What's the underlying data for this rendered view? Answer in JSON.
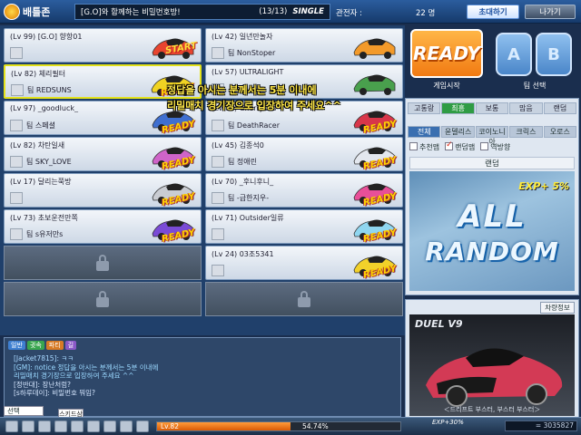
{
  "header": {
    "app_title": "배틀존",
    "room_title": "[G.O]와 함께하는 비밀번호방!",
    "player_count": "(13/13)",
    "mode": "SINGLE",
    "spectator_label": "관전자 :",
    "spectator_count": "22 명",
    "invite_button": "초대하기",
    "exit_button": "나가기"
  },
  "slots": [
    {
      "lv": "(Lv 99) [G.O] 향항01",
      "team": "",
      "car_color": "#e8442f",
      "badge": "START"
    },
    {
      "lv": "(Lv 42) 일년만놀자",
      "team": "팀 NonStoper",
      "car_color": "#f39a2a",
      "badge": ""
    },
    {
      "lv": "(Lv 82) 체리필터",
      "team": "팀 REDSUNS",
      "car_color": "#f0d323",
      "badge": "READY"
    },
    {
      "lv": "(Lv 57) ULTRALIGHT",
      "team": "",
      "car_color": "#49a04d",
      "badge": ""
    },
    {
      "lv": "(Lv 97) _goodluck_",
      "team": "팀 스페셜",
      "car_color": "#3f6fd0",
      "badge": "READY"
    },
    {
      "lv": "(Lv 78) CherryVes",
      "team": "팀 DeathRacer",
      "car_color": "#d8364a",
      "badge": "READY"
    },
    {
      "lv": "(Lv 82) 차탄일새",
      "team": "팀 SKY_LOVE",
      "car_color": "#cf64c9",
      "badge": "READY"
    },
    {
      "lv": "(Lv 45) 김종석0",
      "team": "팀 정애린",
      "car_color": "#e3e7ee",
      "badge": "READY"
    },
    {
      "lv": "(Lv 17) 달리는쭉방",
      "team": "",
      "car_color": "#c9ccd2",
      "badge": "READY"
    },
    {
      "lv": "(Lv 70) _후니후니_",
      "team": "팀 -급한지우-",
      "car_color": "#e84f98",
      "badge": "READY"
    },
    {
      "lv": "(Lv 73) 초보운전만쪽",
      "team": "팀 s유저만s",
      "car_color": "#7a4bd6",
      "badge": "READY"
    },
    {
      "lv": "(Lv 71) Outsider일류",
      "team": "",
      "car_color": "#8fd6f0",
      "badge": "READY"
    },
    {
      "lv": "",
      "team": "",
      "car_color": "",
      "badge": "",
      "locked": true
    },
    {
      "lv": "(Lv 24) 03조5341",
      "team": "",
      "car_color": "#f2d12a",
      "badge": "READY"
    },
    {
      "lv": "",
      "team": "",
      "car_color": "",
      "badge": "",
      "locked": true
    },
    {
      "lv": "",
      "team": "",
      "car_color": "",
      "badge": "",
      "locked": true
    }
  ],
  "notice": {
    "line1": "정답을 아시는 분께서는 5분 이내에",
    "line2": "리밀매치 경기장으로 입장하여 주세요^^"
  },
  "controls": {
    "ready": "READY",
    "ready_caption": "게임시작",
    "team_a": "A",
    "team_b": "B",
    "team_caption": "팀 선택"
  },
  "track": {
    "difficulty_tabs": [
      "고통랑",
      "최흥",
      "보통",
      "맘음",
      "랜덤"
    ],
    "theme_tabs": [
      "전체",
      "윤델리스",
      "코이노니아",
      "크릭스",
      "오로스"
    ],
    "filters": [
      {
        "label": "추천맵",
        "checked": false
      },
      {
        "label": "랜덤맵",
        "checked": true
      },
      {
        "label": "역방향",
        "checked": false
      }
    ],
    "name": "랜덤",
    "exp_bonus": "EXP+ 5%",
    "big_line1": "ALL",
    "big_line2": "RANDOM"
  },
  "car": {
    "info_button": "차량정보",
    "model": "DUEL V9",
    "stats": "＜드리프트 부스터, 부스터 부스터＞"
  },
  "chat": {
    "filters": [
      "일반",
      "귓속",
      "파티",
      "길"
    ],
    "filter_colors": [
      "#3e7fd1",
      "#39a64f",
      "#d77b26",
      "#8a59c7"
    ],
    "lines": [
      "[Jacket7815]: ㅋㅋ",
      "[GM]: notice 정답을 아시는 분께서는 5분 이내에",
      "리밀매치 경기장으로 입장하여 주세요 ^^",
      "[정반대]: 장난처럼?",
      "[s하루데이]: 비밀번호 뭐임?"
    ],
    "select_label": "선택",
    "skill_label": "스키드삼"
  },
  "status": {
    "level": "Lv.82",
    "progress_pct": 54.74,
    "progress_text": "54.74%",
    "exp_label": "EXP+30%",
    "money": "= 3035827"
  }
}
